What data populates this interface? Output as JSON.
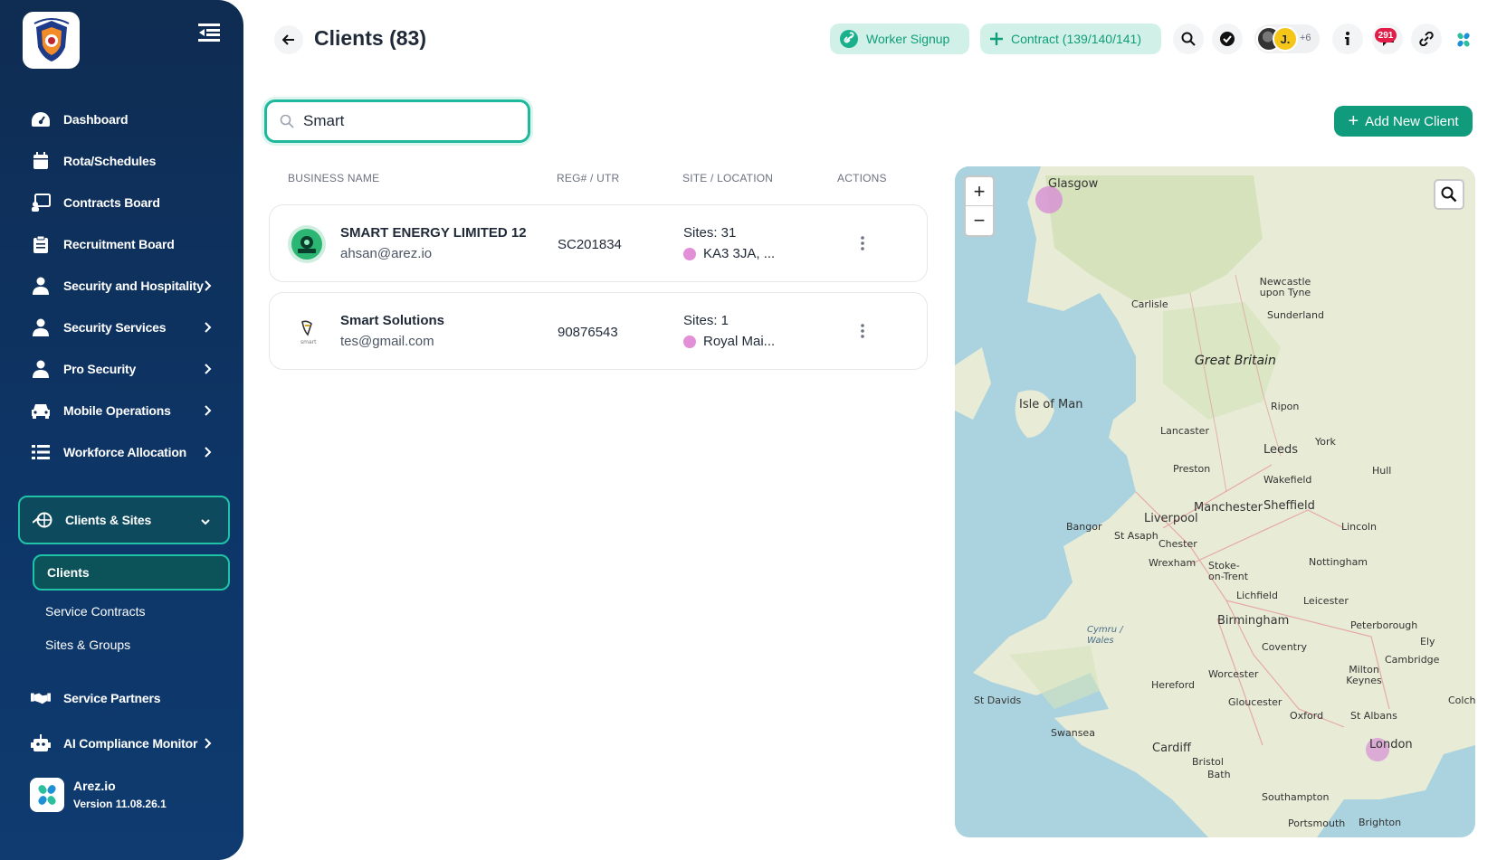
{
  "sidebar": {
    "logo_icon": "shield-crest-icon",
    "items": [
      {
        "label": "Dashboard",
        "icon": "dashboard-icon"
      },
      {
        "label": "Rota/Schedules",
        "icon": "calendar-icon"
      },
      {
        "label": "Contracts Board",
        "icon": "board-icon"
      },
      {
        "label": "Recruitment Board",
        "icon": "clipboard-icon"
      },
      {
        "label": "Security and Hospitality",
        "icon": "user-icon"
      },
      {
        "label": "Security Services",
        "icon": "user-icon"
      },
      {
        "label": "Pro Security",
        "icon": "user-icon"
      },
      {
        "label": "Mobile Operations",
        "icon": "car-icon"
      },
      {
        "label": "Workforce Allocation",
        "icon": "list-icon"
      },
      {
        "label": "Clients & Sites",
        "icon": "globe-hand-icon"
      },
      {
        "label": "Service Partners",
        "icon": "handshake-icon"
      },
      {
        "label": "AI Compliance Monitor",
        "icon": "robot-icon"
      }
    ],
    "sub_items": [
      {
        "label": "Clients"
      },
      {
        "label": "Service Contracts"
      },
      {
        "label": "Sites & Groups"
      }
    ],
    "app_name": "Arez.io",
    "version": "Version 11.08.26.1"
  },
  "header": {
    "title": "Clients (83)",
    "worker_signup": "Worker Signup",
    "contract": "Contract (139/140/141)",
    "avatar_initial": "J.",
    "avatar_more": "+6",
    "notification_count": "291"
  },
  "search": {
    "value": "Smart",
    "placeholder": "Search"
  },
  "add_client_label": "Add New Client",
  "table": {
    "columns": [
      "BUSINESS NAME",
      "REG# / UTR",
      "SITE / LOCATION",
      "ACTIONS"
    ],
    "rows": [
      {
        "name": "SMART ENERGY LIMITED 12",
        "email": "ahsan@arez.io",
        "reg": "SC201834",
        "sites": "Sites: 31",
        "location": "KA3 3JA, ..."
      },
      {
        "name": "Smart Solutions",
        "email": "tes@gmail.com",
        "reg": "90876543",
        "sites": "Sites: 1",
        "location": "Royal Mai..."
      }
    ]
  },
  "map": {
    "labels": [
      "Glasgow",
      "Newcastle upon Tyne",
      "Sunderland",
      "Carlisle",
      "Great Britain",
      "Isle of Man",
      "Ripon",
      "Lancaster",
      "York",
      "Leeds",
      "Preston",
      "Wakefield",
      "Hull",
      "Manchester",
      "Sheffield",
      "Liverpool",
      "Bangor",
      "St Asaph",
      "Chester",
      "Wrexham",
      "Lincoln",
      "Stoke-on-Trent",
      "Nottingham",
      "Lichfield",
      "Leicester",
      "Birmingham",
      "Peterborough",
      "Ely",
      "Coventry",
      "Cambridge",
      "Cymru / Wales",
      "Worcester",
      "Milton Keynes",
      "Hereford",
      "St Davids",
      "Gloucester",
      "Oxford",
      "St Albans",
      "Colche",
      "London",
      "Swansea",
      "Cardiff",
      "Bristol",
      "Bath",
      "Southampton",
      "Portsmouth",
      "Brighton"
    ],
    "zoom_in": "+",
    "zoom_out": "−"
  },
  "colors": {
    "accent": "#109b7c",
    "sidebar": "#0f2c52",
    "site_dot": "#e28fd8",
    "notification": "#e11d48"
  }
}
